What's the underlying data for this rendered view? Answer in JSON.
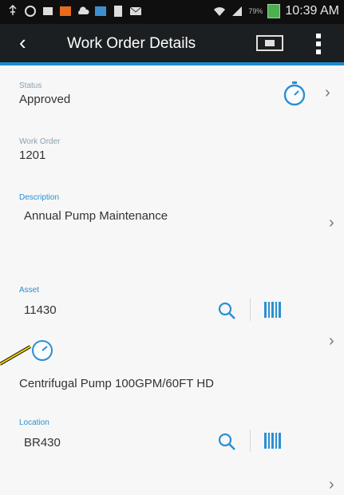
{
  "status_bar": {
    "time": "10:39 AM",
    "battery": "79%"
  },
  "header": {
    "title": "Work Order Details"
  },
  "status": {
    "label": "Status",
    "value": "Approved"
  },
  "work_order": {
    "label": "Work Order",
    "value": "1201"
  },
  "description": {
    "label": "Description",
    "value": "Annual Pump Maintenance"
  },
  "asset": {
    "label": "Asset",
    "value": "11430",
    "description": "Centrifugal Pump 100GPM/60FT HD"
  },
  "location": {
    "label": "Location",
    "value": "BR430"
  },
  "colors": {
    "accent": "#1e8ac8",
    "app_bar": "#1b1f22",
    "icon_blue": "#2b8fd4",
    "callout": "#f0d000"
  },
  "icons": [
    "back-arrow-icon",
    "camera-icon",
    "overflow-menu-icon",
    "stopwatch-icon",
    "search-icon",
    "barcode-icon",
    "meter-gauge-icon",
    "chevron-right-icon"
  ]
}
